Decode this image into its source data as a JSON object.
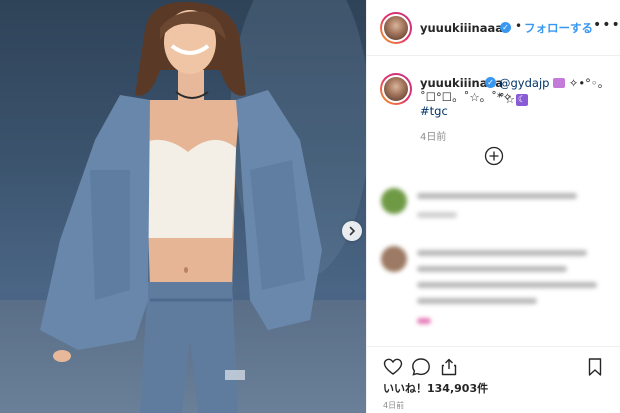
{
  "header": {
    "username": "yuuukiiinaaa",
    "verified_mark": "✓",
    "separator": "•",
    "follow_label": "フォローする",
    "more_label": "•••"
  },
  "caption": {
    "username": "yuuukiiinaaa",
    "verified_mark": "✓",
    "mention": "@gydajp",
    "line1_suffix": "✧•°◦。˚☆⋆。",
    "line2": "˚☐°☐。˚☆。˚*✧",
    "moon_glyph": "☾",
    "hashtag": "#tgc",
    "time_ago": "4日前"
  },
  "engagement": {
    "likes_label": "いいね！134,903件",
    "post_time": "4日前"
  },
  "icons": {
    "load_more": "plus-circle-icon",
    "like": "heart-icon",
    "comment": "comment-bubble-icon",
    "share": "share-icon",
    "save": "bookmark-icon",
    "next": "chevron-right-icon"
  },
  "colors": {
    "link": "#3897f0",
    "hashtag": "#003569",
    "muted": "#8e8e8e",
    "text": "#262626"
  }
}
